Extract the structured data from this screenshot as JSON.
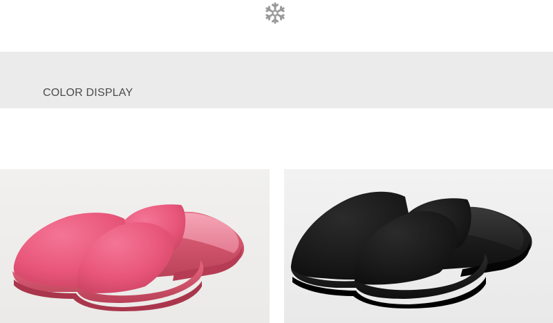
{
  "header": {
    "ornament_icon": "snowflake-icon",
    "ornament_color": "#9a9a9a"
  },
  "section": {
    "title": "COLOR DISPLAY",
    "background": "#ebebeb"
  },
  "products": [
    {
      "color_name": "pink",
      "color_hex": "#e8567a"
    },
    {
      "color_name": "black",
      "color_hex": "#1a1a1a"
    }
  ]
}
